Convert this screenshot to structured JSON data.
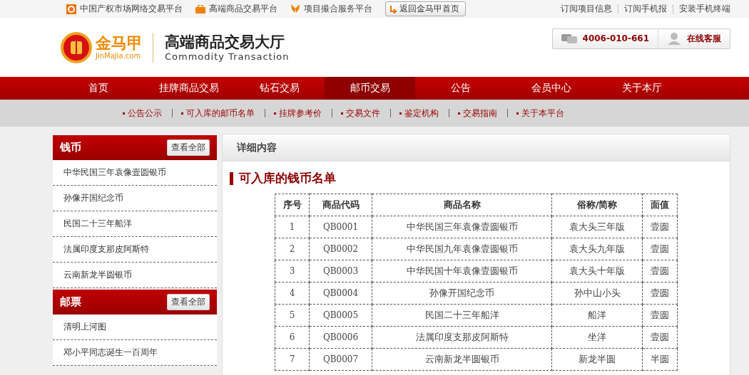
{
  "top_bar": {
    "platforms": [
      {
        "kind": "e",
        "label": "中国产权市场网络交易平台"
      },
      {
        "kind": "bag",
        "label": "高端商品交易平台"
      },
      {
        "kind": "butterfly",
        "label": "项目撮合服务平台"
      }
    ],
    "home_button": "返回金马甲首页",
    "links": [
      "订阅项目信息",
      "订阅手机报",
      "安装手机终端"
    ]
  },
  "header": {
    "logo_name": "金马甲",
    "logo_site": "JinMaJia.com",
    "title": "高端商品交易大厅",
    "subtitle": "Commodity Transaction",
    "phone": "4006-010-661",
    "service": "在线客服"
  },
  "nav": [
    {
      "label": "首页",
      "selected": false
    },
    {
      "label": "挂牌商品交易",
      "selected": false
    },
    {
      "label": "钻石交易",
      "selected": false
    },
    {
      "label": "邮币交易",
      "selected": true
    },
    {
      "label": "公告",
      "selected": false
    },
    {
      "label": "会员中心",
      "selected": false
    },
    {
      "label": "关于本厅",
      "selected": false
    }
  ],
  "subnav": [
    "公告公示",
    "可入库的邮币名单",
    "挂牌参考价",
    "交易文件",
    "鉴定机构",
    "交易指南",
    "关于本平台"
  ],
  "sidebar": [
    {
      "title": "钱币",
      "button": "查看全部",
      "items": [
        "中华民国三年袁像壹圆银币",
        "孙像开国纪念币",
        "民国二十三年船洋",
        "法属印度支那皮阿斯特",
        "云南新龙半圆银币"
      ]
    },
    {
      "title": "邮票",
      "button": "查看全部",
      "items": [
        "清明上河图",
        "邓小平同志诞生一百周年"
      ]
    }
  ],
  "content": {
    "panel_title": "详细内容",
    "heading": "可入库的钱币名单",
    "table": {
      "columns": [
        "序号",
        "商品代码",
        "商品名称",
        "俗称/简称",
        "面值"
      ],
      "rows": [
        [
          "1",
          "QB0001",
          "中华民国三年袁像壹圆银币",
          "袁大头三年版",
          "壹圆"
        ],
        [
          "2",
          "QB0002",
          "中华民国九年袁像壹圆银币",
          "袁大头九年版",
          "壹圆"
        ],
        [
          "3",
          "QB0003",
          "中华民国十年袁像壹圆银币",
          "袁大头十年版",
          "壹圆"
        ],
        [
          "4",
          "QB0004",
          "孙像开国纪念币",
          "孙中山小头",
          "壹圆"
        ],
        [
          "5",
          "QB0005",
          "民国二十三年船洋",
          "船洋",
          "壹圆"
        ],
        [
          "6",
          "QB0006",
          "法属印度支那皮阿斯特",
          "坐洋",
          "壹圆"
        ],
        [
          "7",
          "QB0007",
          "云南新龙半圆银币",
          "新龙半圆",
          "半圆"
        ]
      ]
    }
  }
}
